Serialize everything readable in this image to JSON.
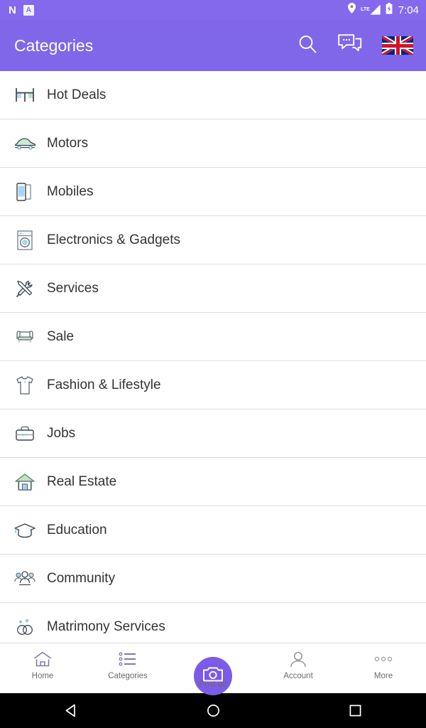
{
  "statusbar": {
    "notif_n": "N",
    "notif_a": "A",
    "network": "LTE",
    "time": "7:04",
    "icons": [
      "location-pin-icon",
      "signal-icon",
      "battery-charging-icon"
    ]
  },
  "appbar": {
    "title": "Categories",
    "search_label": "Search",
    "chat_label": "Chat",
    "language_label": "English (UK)",
    "background": "#8067ea"
  },
  "categories": [
    {
      "label": "Hot Deals",
      "icon": "hot-deals-icon"
    },
    {
      "label": "Motors",
      "icon": "car-icon"
    },
    {
      "label": "Mobiles",
      "icon": "mobile-phone-icon"
    },
    {
      "label": "Electronics & Gadgets",
      "icon": "washing-machine-icon"
    },
    {
      "label": "Services",
      "icon": "tools-icon"
    },
    {
      "label": "Sale",
      "icon": "sofa-icon"
    },
    {
      "label": "Fashion & Lifestyle",
      "icon": "tshirt-icon"
    },
    {
      "label": "Jobs",
      "icon": "briefcase-icon"
    },
    {
      "label": "Real Estate",
      "icon": "house-icon"
    },
    {
      "label": "Education",
      "icon": "graduation-cap-icon"
    },
    {
      "label": "Community",
      "icon": "people-group-icon"
    },
    {
      "label": "Matrimony Services",
      "icon": "wedding-rings-icon"
    }
  ],
  "bottomnav": {
    "items": [
      {
        "label": "Home",
        "icon": "home-icon"
      },
      {
        "label": "Categories",
        "icon": "list-icon"
      },
      {
        "label": "Post ad",
        "icon": "camera-icon"
      },
      {
        "label": "Account",
        "icon": "person-icon"
      },
      {
        "label": "More",
        "icon": "more-dots-icon"
      }
    ],
    "fab_color": "#7b5be8"
  },
  "androidnav": {
    "back": "back-triangle-icon",
    "home": "home-circle-icon",
    "recents": "recents-square-icon"
  }
}
